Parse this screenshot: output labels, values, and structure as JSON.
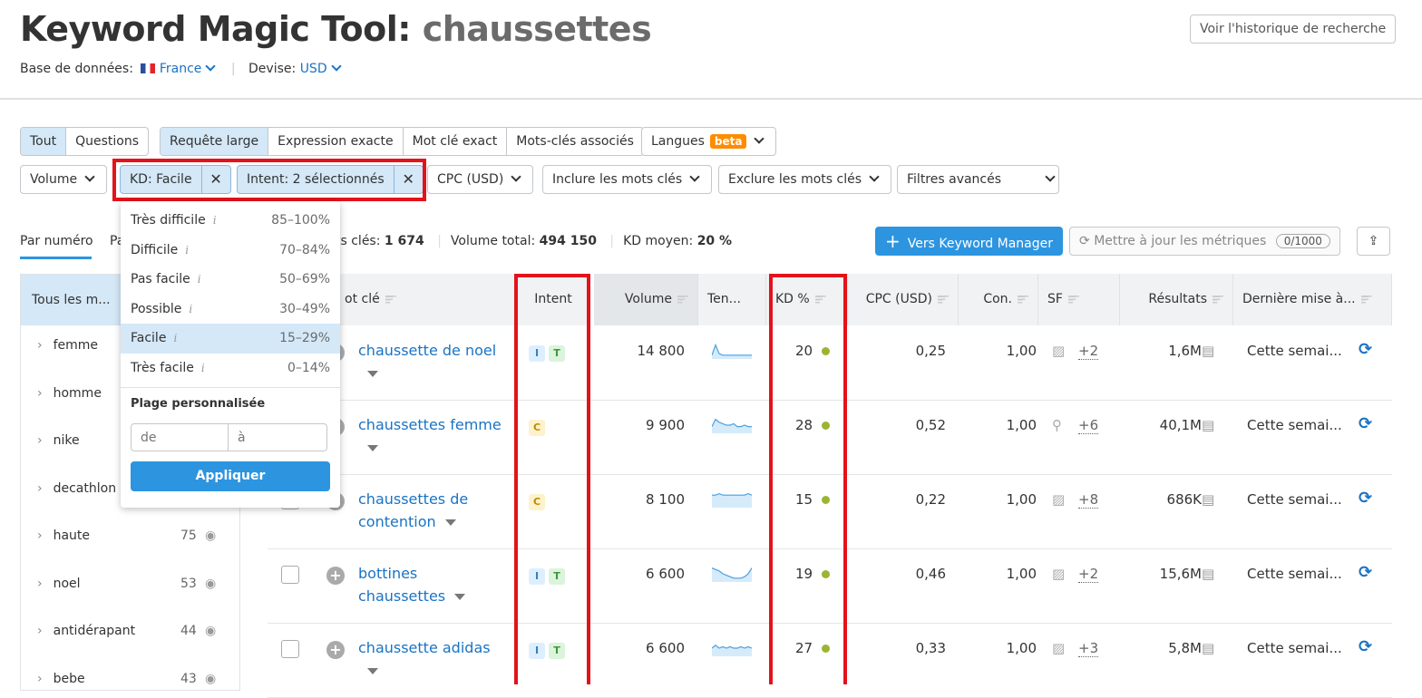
{
  "header": {
    "title": "Keyword Magic Tool:",
    "query": "chaussettes",
    "database_label": "Base de données:",
    "database": "France",
    "currency_label": "Devise:",
    "currency": "USD",
    "history_button": "Voir l'historique de recherche"
  },
  "tabs1": [
    "Tout",
    "Questions"
  ],
  "tabs2": [
    "Requête large",
    "Expression exacte",
    "Mot clé exact",
    "Mots-clés associés"
  ],
  "languages": {
    "label": "Langues",
    "badge": "beta"
  },
  "filters": {
    "volume": "Volume",
    "kd_chip": "KD: Facile",
    "intent_chip": "Intent: 2 sélectionnés",
    "cpc": "CPC (USD)",
    "include": "Inclure les mots clés",
    "exclude": "Exclure les mots clés",
    "advanced": "Filtres avancés"
  },
  "kd_dropdown": {
    "items": [
      {
        "label": "Très difficile",
        "range": "85–100%"
      },
      {
        "label": "Difficile",
        "range": "70–84%"
      },
      {
        "label": "Pas facile",
        "range": "50–69%"
      },
      {
        "label": "Possible",
        "range": "30–49%"
      },
      {
        "label": "Facile",
        "range": "15–29%",
        "selected": true
      },
      {
        "label": "Très facile",
        "range": "0–14%"
      }
    ],
    "custom_label": "Plage personnalisée",
    "from_placeholder": "de",
    "to_placeholder": "à",
    "apply": "Appliquer"
  },
  "view_tabs": {
    "by_number": "Par numéro",
    "other": "Pa"
  },
  "stats": {
    "keywords_label": "ts clés:",
    "keywords": "1 674",
    "volume_label": "Volume total:",
    "volume": "494 150",
    "kd_label": "KD moyen:",
    "kd": "20 %"
  },
  "actions": {
    "keyword_manager": "Vers Keyword Manager",
    "update_metrics": "Mettre à jour les métriques",
    "update_count": "0/1000"
  },
  "sidebar": {
    "header": "Tous les m...",
    "items": [
      {
        "label": "femme",
        "count": ""
      },
      {
        "label": "homme",
        "count": ""
      },
      {
        "label": "nike",
        "count": ""
      },
      {
        "label": "decathlon",
        "count": ""
      },
      {
        "label": "haute",
        "count": "75"
      },
      {
        "label": "noel",
        "count": "53"
      },
      {
        "label": "antidérapant",
        "count": "44"
      },
      {
        "label": "bebe",
        "count": "43"
      }
    ]
  },
  "table": {
    "columns": {
      "keyword": "ot clé",
      "intent": "Intent",
      "volume": "Volume",
      "trend": "Ten...",
      "kd": "KD %",
      "cpc": "CPC (USD)",
      "con": "Con.",
      "sf": "SF",
      "results": "Résultats",
      "updated": "Dernière mise à..."
    },
    "rows": [
      {
        "keyword": "chaussette de noel",
        "intent": [
          "I",
          "T"
        ],
        "volume": "14 800",
        "kd": "20",
        "cpc": "0,25",
        "con": "1,00",
        "sf_icon": "image-icon",
        "sf": "+2",
        "results": "1,6M",
        "updated": "Cette semai...",
        "trend": [
          2,
          9,
          3,
          2,
          2,
          2,
          2,
          2,
          2,
          2,
          2,
          2
        ]
      },
      {
        "keyword": "chaussettes femme",
        "intent": [
          "C"
        ],
        "volume": "9 900",
        "kd": "28",
        "cpc": "0,52",
        "con": "1,00",
        "sf_icon": "map-pin-icon",
        "sf": "+6",
        "results": "40,1M",
        "updated": "Cette semai...",
        "trend": [
          4,
          9,
          7,
          6,
          5,
          5,
          6,
          4,
          4,
          5,
          4,
          4
        ]
      },
      {
        "keyword": "chaussettes de contention",
        "intent": [
          "C"
        ],
        "volume": "8 100",
        "kd": "15",
        "cpc": "0,22",
        "con": "1,00",
        "sf_icon": "image-icon",
        "sf": "+8",
        "results": "686K",
        "updated": "Cette semai...",
        "trend": [
          8,
          8,
          9,
          8,
          8,
          8,
          8,
          8,
          8,
          8,
          9,
          8
        ]
      },
      {
        "keyword": "bottines chaussettes",
        "intent": [
          "I",
          "T"
        ],
        "volume": "6 600",
        "kd": "19",
        "cpc": "0,46",
        "con": "1,00",
        "sf_icon": "image-icon",
        "sf": "+2",
        "results": "15,6M",
        "updated": "Cette semai...",
        "trend": [
          9,
          8,
          7,
          5,
          4,
          3,
          2,
          2,
          2,
          3,
          5,
          9
        ]
      },
      {
        "keyword": "chaussette adidas",
        "intent": [
          "I",
          "T"
        ],
        "volume": "6 600",
        "kd": "27",
        "cpc": "0,33",
        "con": "1,00",
        "sf_icon": "image-icon",
        "sf": "+3",
        "results": "5,8M",
        "updated": "Cette semai...",
        "trend": [
          5,
          7,
          5,
          6,
          5,
          6,
          5,
          5,
          6,
          5,
          6,
          5
        ]
      }
    ]
  },
  "colors": {
    "accent": "#2d94e0",
    "highlight": "#e3131b",
    "kd_easy": "#9ab531"
  }
}
